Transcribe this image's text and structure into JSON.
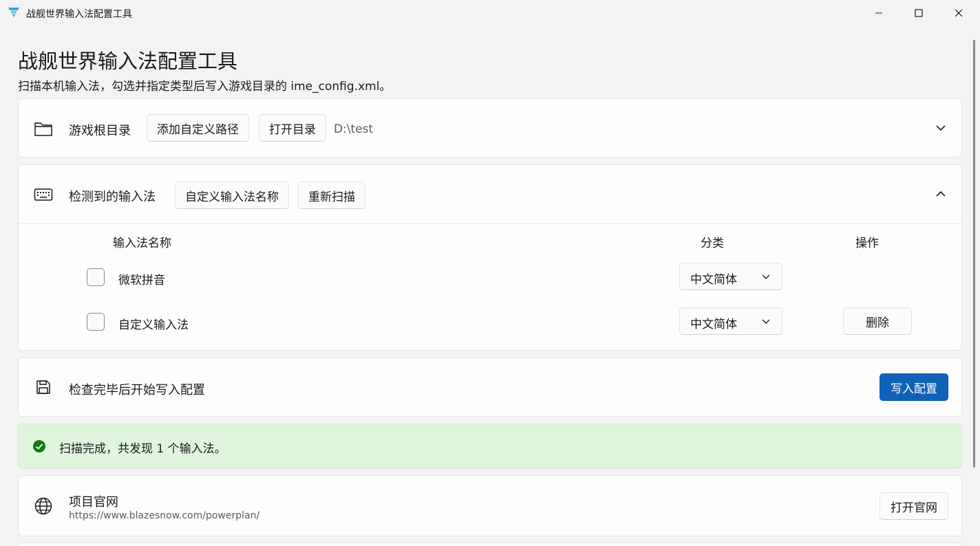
{
  "window": {
    "title": "战舰世界输入法配置工具",
    "app_icon": "ime-logo-icon"
  },
  "header": {
    "title": "战舰世界输入法配置工具",
    "subtitle": "扫描本机输入法，勾选并指定类型后写入游戏目录的 ime_config.xml。"
  },
  "game_dir": {
    "icon": "folder-icon",
    "label": "游戏根目录",
    "add_path_label": "添加自定义路径",
    "open_dir_label": "打开目录",
    "path": "D:\\test",
    "expanded": false
  },
  "ime_list": {
    "icon": "keyboard-icon",
    "label": "检测到的输入法",
    "custom_name_label": "自定义输入法名称",
    "rescan_label": "重新扫描",
    "expanded": true,
    "columns": [
      "输入法名称",
      "分类",
      "操作"
    ],
    "rows": [
      {
        "name": "微软拼音",
        "checked": false,
        "category": "中文简体",
        "action": ""
      },
      {
        "name": "自定义输入法",
        "checked": false,
        "category": "中文简体",
        "action": "删除"
      }
    ]
  },
  "write": {
    "icon": "save-icon",
    "label": "检查完毕后开始写入配置",
    "button_label": "写入配置",
    "accent_color": "#0f62b8"
  },
  "status": {
    "icon": "success-check-icon",
    "text": "扫描完成，共发现 1 个输入法。",
    "color": "#0f7b0f",
    "background": "#dff6dd"
  },
  "website": {
    "icon": "globe-icon",
    "title": "项目官网",
    "url": "https://www.blazesnow.com/powerplan/",
    "button_label": "打开官网"
  }
}
